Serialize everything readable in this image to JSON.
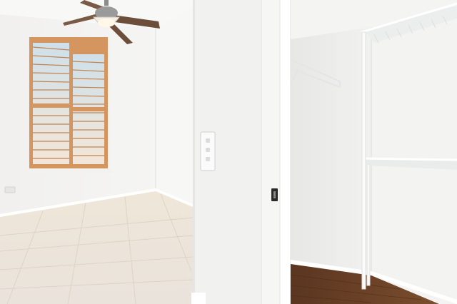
{
  "scene": {
    "rooms": [
      "bedroom",
      "walk-in-closet"
    ],
    "floor_bedroom": "tile",
    "floor_closet": "hardwood",
    "colors": {
      "wall": "#f2f1ef",
      "tile": "#ece5d8",
      "wood": "#6b4328",
      "window_frame": "#d4955e",
      "shelf_wire": "#e9ebea"
    },
    "icons": [
      "ceiling-fan-icon",
      "light-switch-icon",
      "door-latch-icon"
    ]
  }
}
